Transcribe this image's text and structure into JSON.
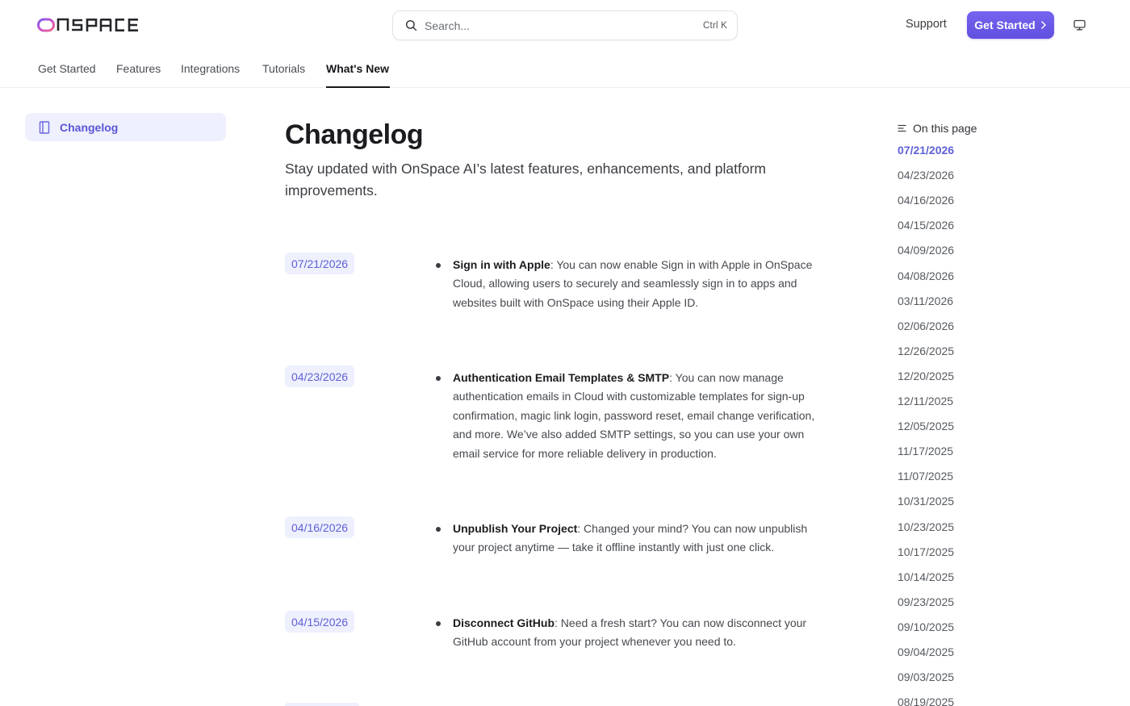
{
  "header": {
    "logo_text": "ONSPACE",
    "search_placeholder": "Search...",
    "search_shortcut": "Ctrl K",
    "support_label": "Support",
    "cta_label": "Get Started",
    "icons": {
      "search": "search-icon",
      "cta_chevron": "chevron-right-icon",
      "theme": "monitor-icon"
    }
  },
  "nav": {
    "tabs": [
      {
        "label": "Get Started"
      },
      {
        "label": "Features"
      },
      {
        "label": "Integrations"
      },
      {
        "label": "Tutorials"
      },
      {
        "label": "What's New",
        "active": true
      }
    ]
  },
  "sidebar": {
    "items": [
      {
        "label": "Changelog",
        "icon": "book-icon",
        "active": true
      }
    ]
  },
  "main": {
    "title": "Changelog",
    "subtitle": "Stay updated with OnSpace AI’s latest features, enhancements, and platform improvements.",
    "entries": [
      {
        "date": "07/21/2026",
        "heading": "Sign in with Apple",
        "body": ": You can now enable Sign in with Apple in OnSpace Cloud, allowing users to securely and seamlessly sign in to apps and websites built with OnSpace using their Apple ID."
      },
      {
        "date": "04/23/2026",
        "heading": "Authentication Email Templates & SMTP",
        "body": ": You can now manage authentication emails in Cloud with customizable templates for sign-up confirmation, magic link login, password reset, email change verification, and more. We’ve also added SMTP settings, so you can use your own email service for more reliable delivery in production."
      },
      {
        "date": "04/16/2026",
        "heading": "Unpublish Your Project",
        "body": ": Changed your mind? You can now unpublish your project anytime — take it offline instantly with just one click."
      },
      {
        "date": "04/15/2026",
        "heading": "Disconnect GitHub",
        "body": ": Need a fresh start? You can now disconnect your GitHub account from your project whenever you need to."
      }
    ]
  },
  "toc": {
    "heading": "On this page",
    "icon": "list-icon",
    "items": [
      "07/21/2026",
      "04/23/2026",
      "04/16/2026",
      "04/15/2026",
      "04/09/2026",
      "04/08/2026",
      "03/11/2026",
      "02/06/2026",
      "12/26/2025",
      "12/20/2025",
      "12/11/2025",
      "12/05/2025",
      "11/17/2025",
      "11/07/2025",
      "10/31/2025",
      "10/23/2025",
      "10/17/2025",
      "10/14/2025",
      "09/23/2025",
      "09/10/2025",
      "09/04/2025",
      "09/03/2025",
      "08/19/2025"
    ],
    "active_index": 0
  },
  "colors": {
    "accent": "#6d5ce8",
    "accent_text": "#5e61d4",
    "chip_bg": "#eef0fd",
    "text_primary": "#1b1c1f"
  }
}
